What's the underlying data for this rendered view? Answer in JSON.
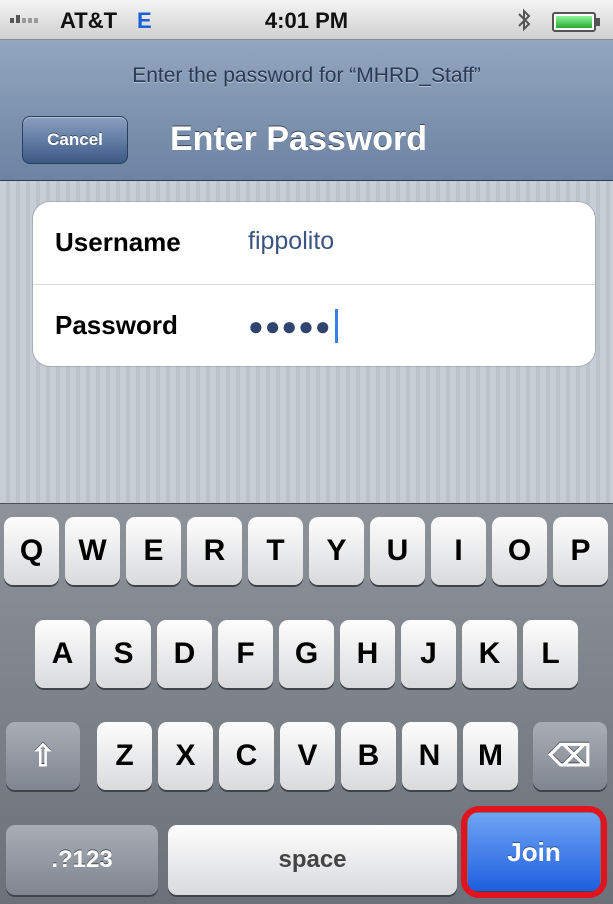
{
  "status_bar": {
    "carrier": "AT&T",
    "network": "E",
    "time": "4:01 PM",
    "bluetooth_icon": "bluetooth-icon",
    "battery_icon": "battery-icon"
  },
  "nav": {
    "prompt": "Enter the password for “MHRD_Staff”",
    "cancel_label": "Cancel",
    "title": "Enter Password"
  },
  "form": {
    "username_label": "Username",
    "username_value": "fippolito",
    "password_label": "Password",
    "password_mask": "●●●●●"
  },
  "keyboard": {
    "row1": [
      "Q",
      "W",
      "E",
      "R",
      "T",
      "Y",
      "U",
      "I",
      "O",
      "P"
    ],
    "row2": [
      "A",
      "S",
      "D",
      "F",
      "G",
      "H",
      "J",
      "K",
      "L"
    ],
    "row3": [
      "Z",
      "X",
      "C",
      "V",
      "B",
      "N",
      "M"
    ],
    "shift_glyph": "⇧",
    "delete_glyph": "⌫",
    "numbers_label": ".?123",
    "space_label": "space",
    "join_label": "Join"
  },
  "colors": {
    "join_blue": "#1e5fe0",
    "highlight_red": "#e0141e",
    "nav_blue": "#7f94b0"
  }
}
